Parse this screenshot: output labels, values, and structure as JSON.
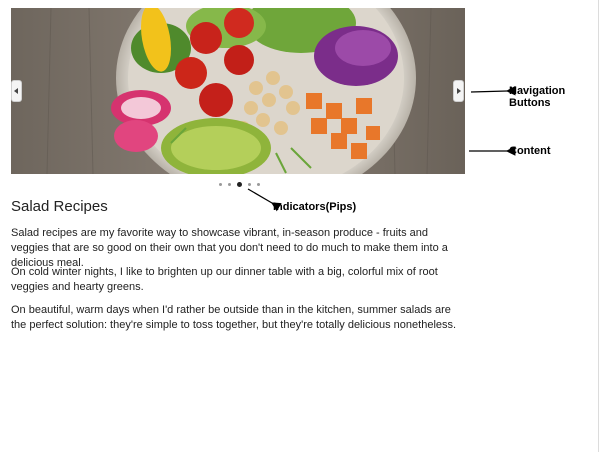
{
  "carousel": {
    "image_alt": "Bowl of salad with tomatoes, chickpeas, avocado, radish, cabbage and sweet potato",
    "pips": {
      "count": 5,
      "active_index": 2
    }
  },
  "annotations": {
    "navigation_buttons": "Navigation Buttons",
    "content": "Content",
    "indicators": "Indicators(Pips)"
  },
  "article": {
    "title": "Salad Recipes",
    "paragraphs": [
      "Salad recipes are my favorite way to showcase vibrant, in-season produce - fruits and veggies that are so good on their own that you don't need to do much to make them into a delicious meal.",
      "On cold winter nights, I like to brighten up our dinner table with a big, colorful mix of root veggies and hearty greens.",
      "On beautiful, warm days when I'd rather be outside than in the kitchen, summer salads are the perfect solution: they're simple to toss together, but they're totally delicious nonetheless."
    ]
  }
}
